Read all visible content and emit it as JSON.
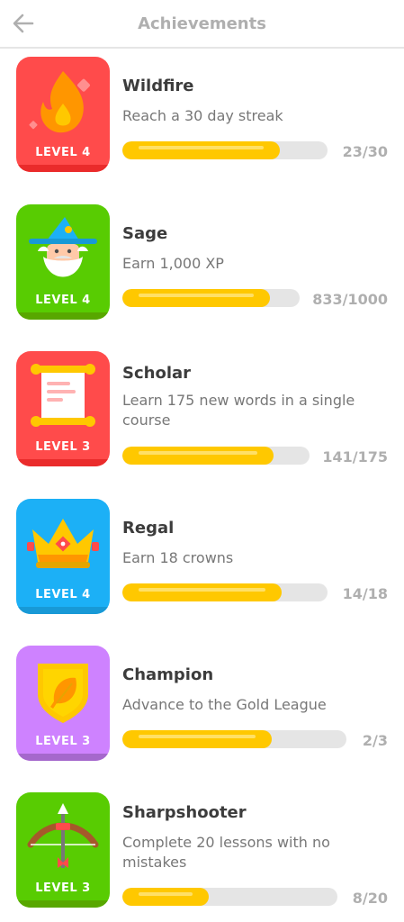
{
  "header": {
    "title": "Achievements"
  },
  "achievements": [
    {
      "name": "Wildfire",
      "description": "Reach a 30 day streak",
      "level": "LEVEL 4",
      "progress": "23/30",
      "fraction": 0.767,
      "color": "#ff4b4b",
      "icon": "fire-icon"
    },
    {
      "name": "Sage",
      "description": "Earn 1,000 XP",
      "level": "LEVEL 4",
      "progress": "833/1000",
      "fraction": 0.833,
      "color": "#58cc02",
      "icon": "wizard-icon"
    },
    {
      "name": "Scholar",
      "description": "Learn 175 new words in a single course",
      "level": "LEVEL 3",
      "progress": "141/175",
      "fraction": 0.806,
      "color": "#ff4b4b",
      "icon": "scroll-icon"
    },
    {
      "name": "Regal",
      "description": "Earn 18 crowns",
      "level": "LEVEL 4",
      "progress": "14/18",
      "fraction": 0.778,
      "color": "#1cb0f6",
      "icon": "crown-icon"
    },
    {
      "name": "Champion",
      "description": "Advance to the Gold League",
      "level": "LEVEL 3",
      "progress": "2/3",
      "fraction": 0.667,
      "color": "#ce82ff",
      "icon": "shield-icon"
    },
    {
      "name": "Sharpshooter",
      "description": "Complete 20 lessons with no mistakes",
      "level": "LEVEL 3",
      "progress": "8/20",
      "fraction": 0.4,
      "color": "#58cc02",
      "icon": "bow-arrow-icon"
    }
  ]
}
